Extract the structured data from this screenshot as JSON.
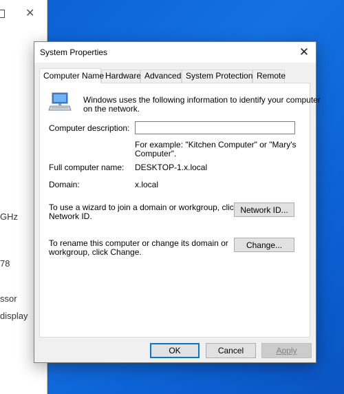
{
  "background_window": {
    "lines": [
      "GHz",
      "78",
      "ssor",
      "display"
    ]
  },
  "dialog": {
    "title": "System Properties",
    "tabs": [
      {
        "label": "Computer Name",
        "active": true
      },
      {
        "label": "Hardware",
        "active": false
      },
      {
        "label": "Advanced",
        "active": false
      },
      {
        "label": "System Protection",
        "active": false
      },
      {
        "label": "Remote",
        "active": false
      }
    ],
    "computer_name": {
      "intro_line1": "Windows uses the following information to identify your computer",
      "intro_line2": "on the network.",
      "description_label": "Computer description:",
      "description_value": "",
      "example_line1": "For example: \"Kitchen Computer\" or \"Mary's",
      "example_line2": "Computer\".",
      "full_name_label": "Full computer name:",
      "full_name_value": "DESKTOP-1.x.local",
      "domain_label": "Domain:",
      "domain_value": "x.local",
      "wizard_line1": "To use a wizard to join a domain or workgroup, click",
      "wizard_line2": "Network ID.",
      "network_id_button": "Network ID...",
      "rename_line1": "To rename this computer or change its domain or",
      "rename_line2": "workgroup, click Change.",
      "change_button": "Change..."
    },
    "buttons": {
      "ok": "OK",
      "cancel": "Cancel",
      "apply": "Apply"
    }
  },
  "icons": {
    "computer": "computer-icon",
    "close": "close-icon"
  },
  "colors": {
    "desktop": "#0b5ed3",
    "dialog_bg": "#f0f0f0",
    "default_button_border": "#0078d7"
  }
}
